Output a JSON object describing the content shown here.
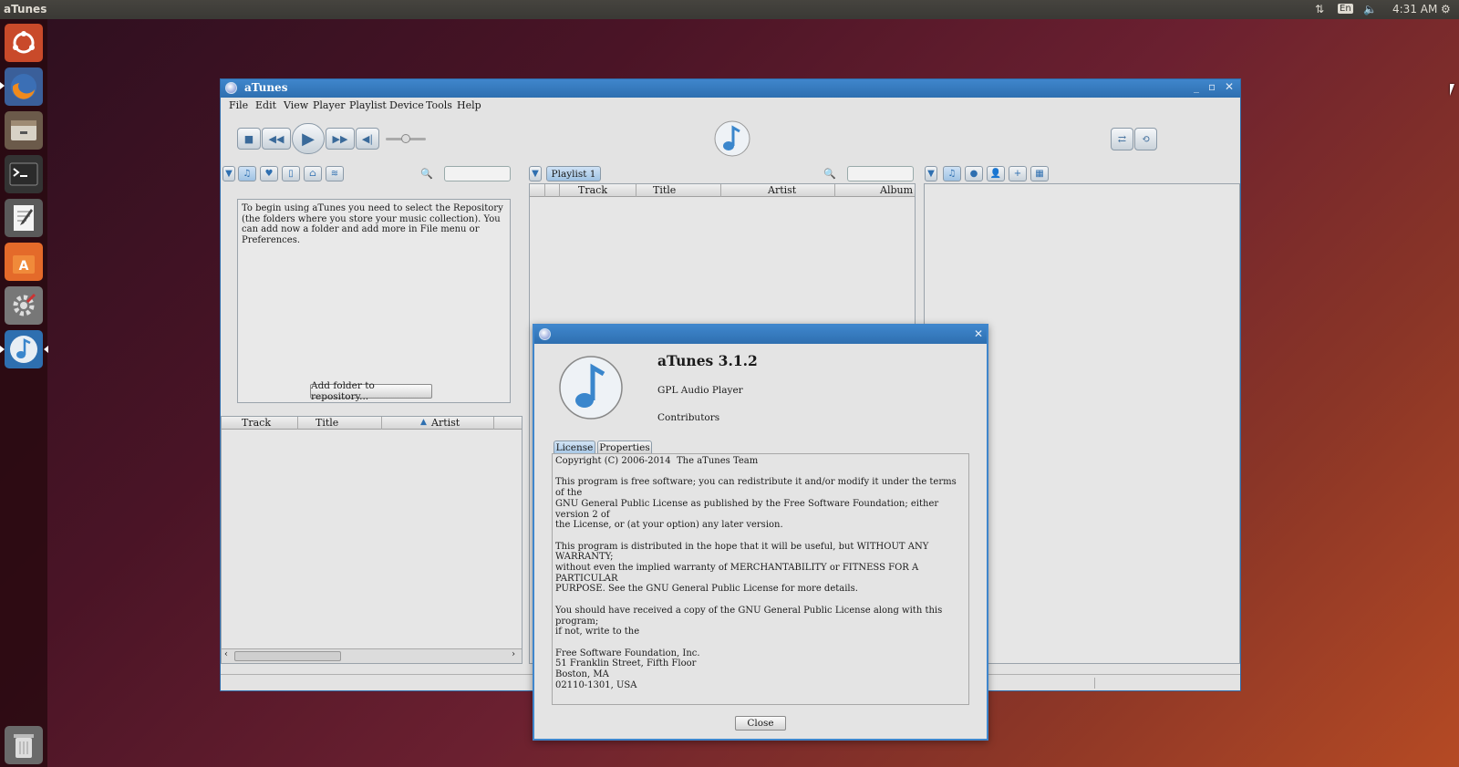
{
  "topbar": {
    "app_name": "aTunes",
    "keyboard": "En",
    "time": "4:31 AM"
  },
  "launcher": {
    "items": [
      "ubuntu-dash-icon",
      "firefox-icon",
      "files-icon",
      "terminal-icon",
      "text-editor-icon",
      "software-center-icon",
      "system-settings-icon",
      "atunes-icon",
      "trash-icon"
    ]
  },
  "window": {
    "title": "aTunes",
    "menu": [
      "File",
      "Edit",
      "View",
      "Player",
      "Playlist",
      "Device",
      "Tools",
      "Help"
    ]
  },
  "navigator": {
    "message": "To begin using aTunes you need to select the Repository (the folders where you store your music collection). You can add now a folder and add more in File menu or Preferences.",
    "add_folder_button": "Add folder to repository...",
    "columns": [
      "Track",
      "Title",
      "Artist"
    ],
    "sort_indicator": "▲"
  },
  "playlist": {
    "tab": "Playlist 1",
    "columns": [
      "Track",
      "Title",
      "Artist",
      "Album"
    ]
  },
  "about": {
    "app_title": "aTunes 3.1.2",
    "subtitle": "GPL Audio Player",
    "contributors": "Contributors",
    "tabs": [
      "License",
      "Properties"
    ],
    "license_text": "Copyright (C) 2006-2014  The aTunes Team\n\nThis program is free software; you can redistribute it and/or modify it under the terms of the\nGNU General Public License as published by the Free Software Foundation; either version 2 of\nthe License, or (at your option) any later version.\n\nThis program is distributed in the hope that it will be useful, but WITHOUT ANY WARRANTY;\nwithout even the implied warranty of MERCHANTABILITY or FITNESS FOR A PARTICULAR\nPURPOSE. See the GNU General Public License for more details.\n\nYou should have received a copy of the GNU General Public License along with this program;\nif not, write to the\n\nFree Software Foundation, Inc.\n51 Franklin Street, Fifth Floor\nBoston, MA\n02110-1301, USA",
    "close_button": "Close"
  },
  "colors": {
    "accent": "#2e6fb0",
    "titlebar": "#3f86cc"
  }
}
